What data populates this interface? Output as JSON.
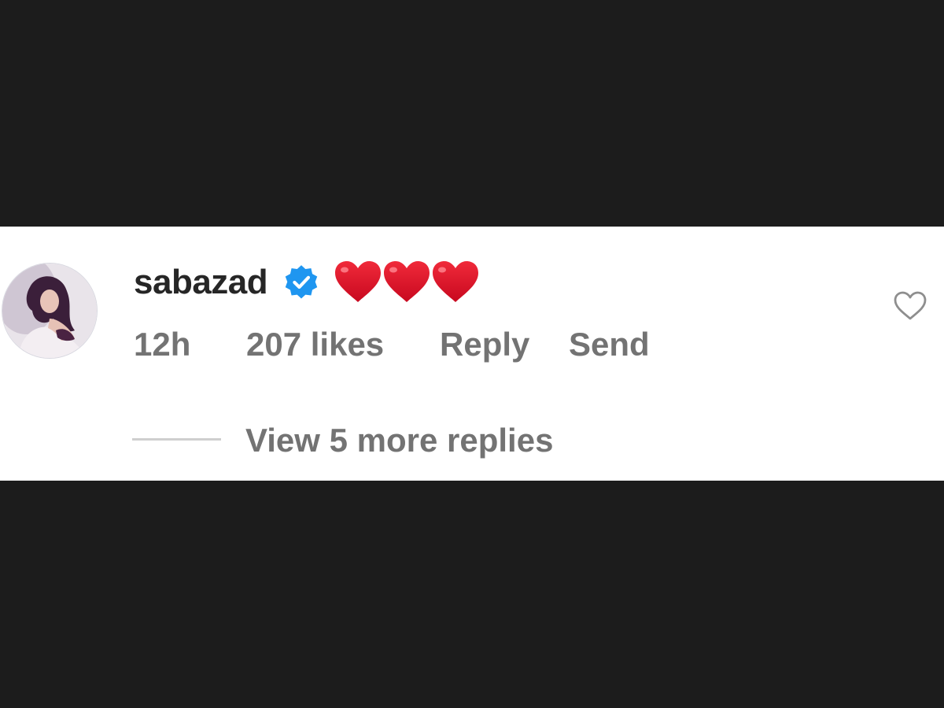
{
  "comment": {
    "username": "sabazad",
    "verified": true,
    "text": "❤️❤️❤️",
    "time": "12h",
    "likes": "207 likes",
    "reply_label": "Reply",
    "send_label": "Send",
    "like_icon": "heart-outline-icon"
  },
  "replies": {
    "view_more_label": "View 5 more replies"
  },
  "colors": {
    "background": "#1c1c1c",
    "panel": "#ffffff",
    "username": "#262626",
    "meta": "#737373",
    "verified_badge": "#1f96f0",
    "heart": "#e0102a"
  }
}
